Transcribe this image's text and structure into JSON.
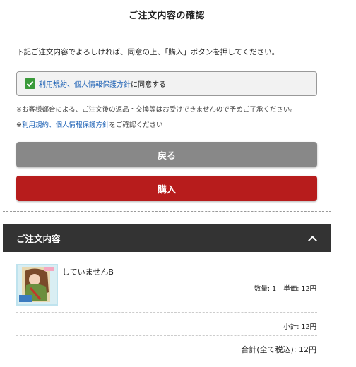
{
  "page": {
    "title": "ご注文内容の確認",
    "intro": "下記ご注文内容でよろしければ、同意の上、「購入」ボタンを押してください。"
  },
  "agreement": {
    "checked": true,
    "link_text": "利用規約、個人情報保護方針",
    "suffix": "に同意する"
  },
  "notes": {
    "cancel_notice": "※お客様都合による、ご注文後の返品・交換等はお受けできませんので予めご了承ください。",
    "confirm_prefix": "※",
    "confirm_link": "利用規約、個人情報保護方針",
    "confirm_suffix": "をご確認ください"
  },
  "buttons": {
    "back_label": "戻る",
    "buy_label": "購入"
  },
  "order": {
    "header_title": "ご注文内容",
    "item": {
      "name": "していませんB",
      "quantity_text": "数量: 1",
      "unit_price_text": "単価: 12円"
    },
    "subtotal_text": "小計: 12円",
    "total_text": "合計(全て税込): 12円"
  },
  "colors": {
    "buy_button": "#b71c1c",
    "back_button": "#888888",
    "checkbox": "#3a9a3a",
    "link": "#1a5fb4",
    "order_header": "#333333"
  }
}
